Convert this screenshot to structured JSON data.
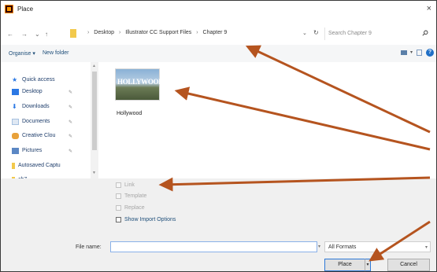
{
  "window": {
    "title": "Place",
    "close_glyph": "×"
  },
  "nav": {
    "back": "←",
    "forward": "→",
    "history": "⌄",
    "up": "↑",
    "breadcrumbs": [
      "Desktop",
      "Illustrator CC Support Files",
      "Chapter 9"
    ],
    "breadcrumb_sep": "›",
    "lead_sep": "›",
    "address_dropdown": "⌄",
    "refresh": "↻",
    "search_placeholder": "Search Chapter 9",
    "search_icon": "search-icon"
  },
  "toolbar": {
    "organise": "Organise ▾",
    "new_folder": "New folder",
    "help": "?"
  },
  "sidebar": {
    "items": [
      {
        "label": "Quick access",
        "icon": "star-icon",
        "color": "#2b78e4",
        "pinned": false
      },
      {
        "label": "Desktop",
        "icon": "desktop-icon",
        "color": "#2b78e4",
        "pinned": true
      },
      {
        "label": "Downloads",
        "icon": "download-icon",
        "color": "#2b78e4",
        "pinned": true
      },
      {
        "label": "Documents",
        "icon": "documents-icon",
        "color": "#a6c1e0",
        "pinned": true
      },
      {
        "label": "Creative Clou",
        "icon": "creative-cloud-icon",
        "color": "#e8a13a",
        "pinned": true
      },
      {
        "label": "Pictures",
        "icon": "pictures-icon",
        "color": "#5b87c4",
        "pinned": true
      },
      {
        "label": "Autosaved Captu",
        "icon": "folder-icon",
        "color": "#f2c94c",
        "pinned": false
      },
      {
        "label": "ch7",
        "icon": "folder-icon",
        "color": "#f2c94c",
        "pinned": false
      }
    ],
    "pin_glyph": "✎"
  },
  "files": [
    {
      "name": "Hollywood",
      "thumb_text": "HOLLYWOOD"
    }
  ],
  "options": {
    "link": "Link",
    "template": "Template",
    "replace": "Replace",
    "show_import": "Show Import Options"
  },
  "footer": {
    "file_name_label": "File name:",
    "file_name_value": "",
    "format": "All Formats",
    "place": "Place",
    "cancel": "Cancel"
  },
  "annotation": {
    "arrow_color": "#b5541f"
  }
}
